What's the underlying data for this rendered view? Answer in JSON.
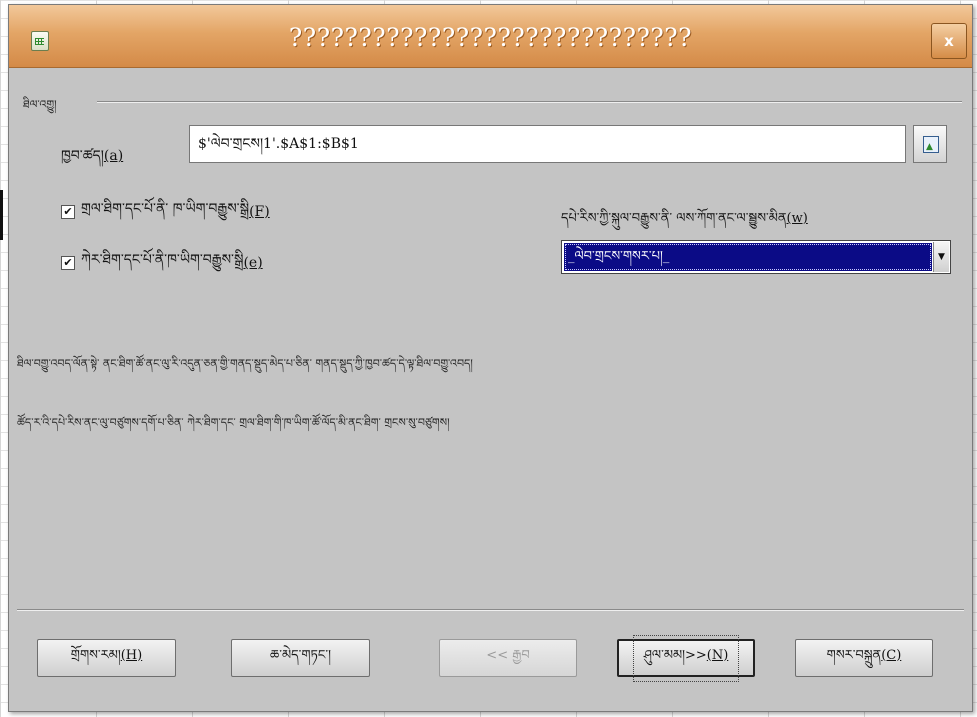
{
  "dialog": {
    "title": "?????????????????????????????",
    "close_label": "x"
  },
  "range_section": {
    "label": "ཐིལ་འགྱུ།",
    "range_label_main": "ཁྱབ་ཚད།",
    "range_label_key": "(a)",
    "range_value": "$'ལེབ་གྲངས།1'.$A$1:$B$1",
    "checkbox_first_row": {
      "checked": true,
      "label_main": "གྲལ་ཐིག་དང་པོ་ནི་ ཁ་ཡིག་བརྒྱུས་སྒྲི",
      "label_key": "(F)"
    },
    "checkbox_first_column": {
      "checked": true,
      "label_main": "ཀེར་ཐིག་དང་པོ་ནི་ཁ་ཡིག་བརྒྱུས་སྒྲི",
      "label_key": "(e)"
    },
    "language_label_main": "དཔེ་རིས་ཀྱི་སྐུལ་བརྒྱུས་ནི་ ལས་ཀོག་ནང་ལ་སྦྱུས་མིན",
    "language_label_key": "(w)",
    "language_selected": "_ལེབ་གྲངས་གསར་པ།_"
  },
  "info": {
    "line1": "ཐིལ་བགྱུ་འབད་ལོན་སྟེ་ ནང་ཐིག་ཚོ་ནང་ལུ་རི་འདུན་ཅན་གྱི་གནད་སྡུད་མེད་པ་ཅིན་ གནད་སྡུད་ཀྱི་ཁྱབ་ཚད་དེ་ལྟ་ཐིལ་བགྱུ་འབད།",
    "line2": "ཚོད་ར་འི་དཔེ་རིས་ནང་ལུ་བཙུགས་དགོ་པ་ཅིན་ ཀེར་ཐིག་དང་ གྲལ་ཐིག་གི་ཁ་ཡིག་ཚོ་ལོད་མི་ནང་ཐིག་ གྲངས་སུ་བཙུགས།"
  },
  "buttons": {
    "help_main": "གྲོགས་རམ།",
    "help_key": "(H)",
    "cancel": "ཆ་མེད་གཏང་།",
    "back": "<< རྒྱབ",
    "next_main": "ཤུལ་མམ།>>",
    "next_key": "(N)",
    "create_main": "གསར་བསྐྲུན",
    "create_key": "(C)"
  }
}
